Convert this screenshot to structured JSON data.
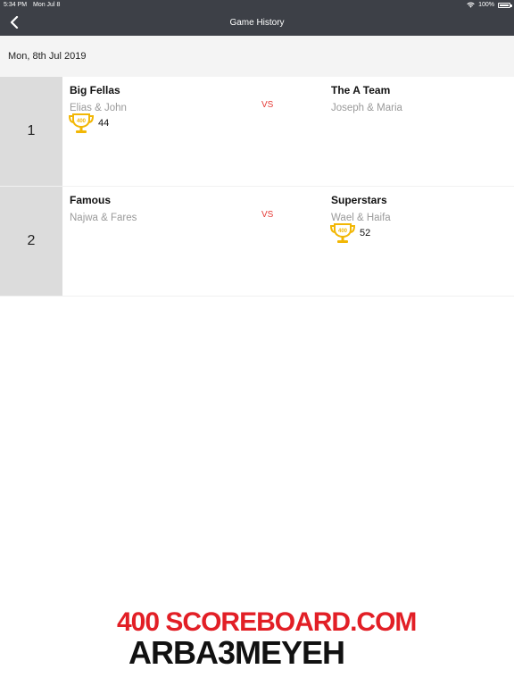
{
  "status_bar": {
    "time": "5:34 PM",
    "date": "Mon Jul 8",
    "battery": "100%"
  },
  "nav": {
    "title": "Game History",
    "back_icon": "chevron-left-icon"
  },
  "date_header": "Mon, 8th Jul 2019",
  "games": [
    {
      "number": "1",
      "team_a": {
        "name": "Big Fellas",
        "players": "Elias & John"
      },
      "team_b": {
        "name": "The A Team",
        "players": "Joseph & Maria"
      },
      "vs": "VS",
      "winner": "team_a",
      "winner_score": "44"
    },
    {
      "number": "2",
      "team_a": {
        "name": "Famous",
        "players": "Najwa & Fares"
      },
      "team_b": {
        "name": "Superstars",
        "players": "Wael & Haifa"
      },
      "vs": "VS",
      "winner": "team_b",
      "winner_score": "52"
    }
  ],
  "trophy_label": "400",
  "promo": {
    "line1": "400 SCOREBOARD.COM",
    "line2": "ARBA3MEYEH"
  },
  "colors": {
    "nav_bg": "#3d4047",
    "vs": "#e53935",
    "trophy": "#f2b705",
    "promo_red": "#e21f26"
  }
}
